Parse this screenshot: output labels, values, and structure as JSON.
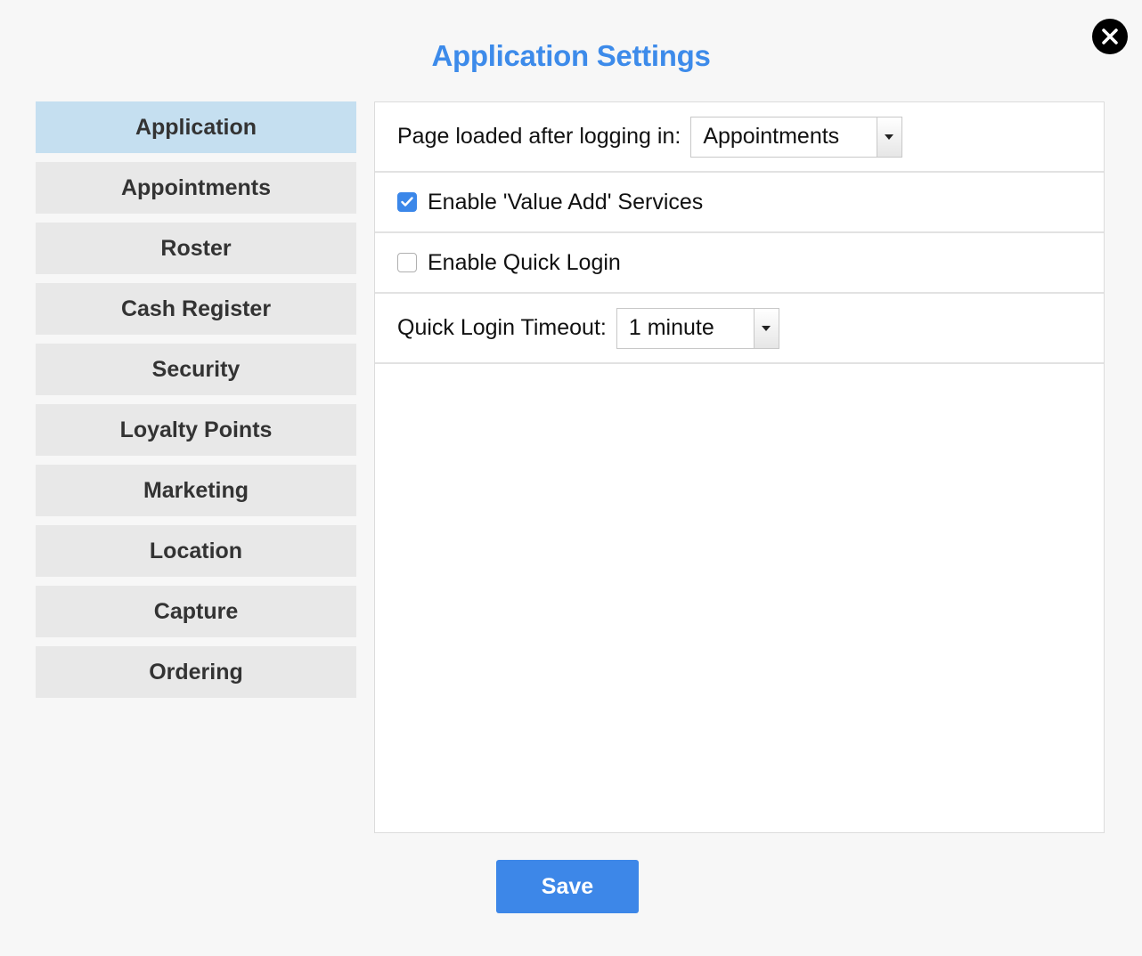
{
  "header": {
    "title": "Application Settings"
  },
  "sidebar": {
    "items": [
      {
        "label": "Application"
      },
      {
        "label": "Appointments"
      },
      {
        "label": "Roster"
      },
      {
        "label": "Cash Register"
      },
      {
        "label": "Security"
      },
      {
        "label": "Loyalty Points"
      },
      {
        "label": "Marketing"
      },
      {
        "label": "Location"
      },
      {
        "label": "Capture"
      },
      {
        "label": "Ordering"
      }
    ],
    "active_index": 0
  },
  "settings": {
    "page_after_login": {
      "label": "Page loaded after logging in:",
      "value": "Appointments"
    },
    "value_add": {
      "label": "Enable 'Value Add' Services",
      "checked": true
    },
    "quick_login": {
      "label": "Enable Quick Login",
      "checked": false
    },
    "quick_login_timeout": {
      "label": "Quick Login Timeout:",
      "value": "1 minute"
    }
  },
  "footer": {
    "save_label": "Save"
  },
  "icons": {
    "close": "close-icon",
    "check": "check-icon",
    "dropdown": "chevron-down-icon"
  },
  "colors": {
    "accent": "#3d8bea",
    "active_tab": "#c5dff0",
    "tab": "#e8e8e8",
    "save_button": "#3d87e8"
  }
}
